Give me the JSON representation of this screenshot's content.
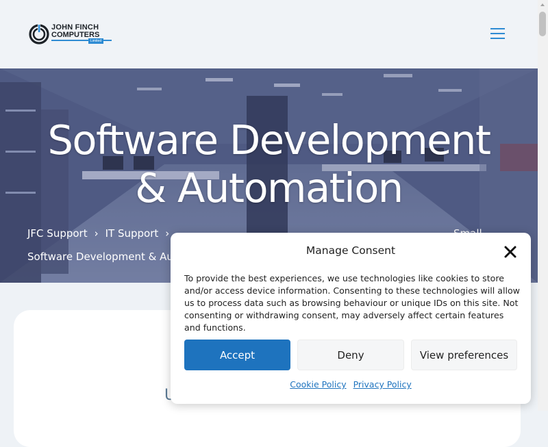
{
  "header": {
    "logo": {
      "line1": "JOHN FINCH",
      "line2": "COMPUTERS",
      "tagline": "Limited"
    },
    "menu_icon": "hamburger-menu-icon",
    "accent_color": "#2e8bd3"
  },
  "hero": {
    "title_line1": "Software Development",
    "title_line2": "& Automation",
    "breadcrumb": {
      "items": [
        "JFC Support",
        "IT Support"
      ],
      "current": "Software Development & Automation"
    },
    "side_text": "Small"
  },
  "content": {
    "peek_text": "U"
  },
  "consent": {
    "title": "Manage Consent",
    "body": "To provide the best experiences, we use technologies like cookies to store and/or access device information. Consenting to these technologies will allow us to process data such as browsing behaviour or unique IDs on this site. Not consenting or withdrawing consent, may adversely affect certain features and functions.",
    "buttons": {
      "accept": "Accept",
      "deny": "Deny",
      "preferences": "View preferences"
    },
    "links": {
      "cookie_policy": "Cookie Policy",
      "privacy_policy": "Privacy Policy"
    },
    "accent_color": "#1e73be"
  }
}
